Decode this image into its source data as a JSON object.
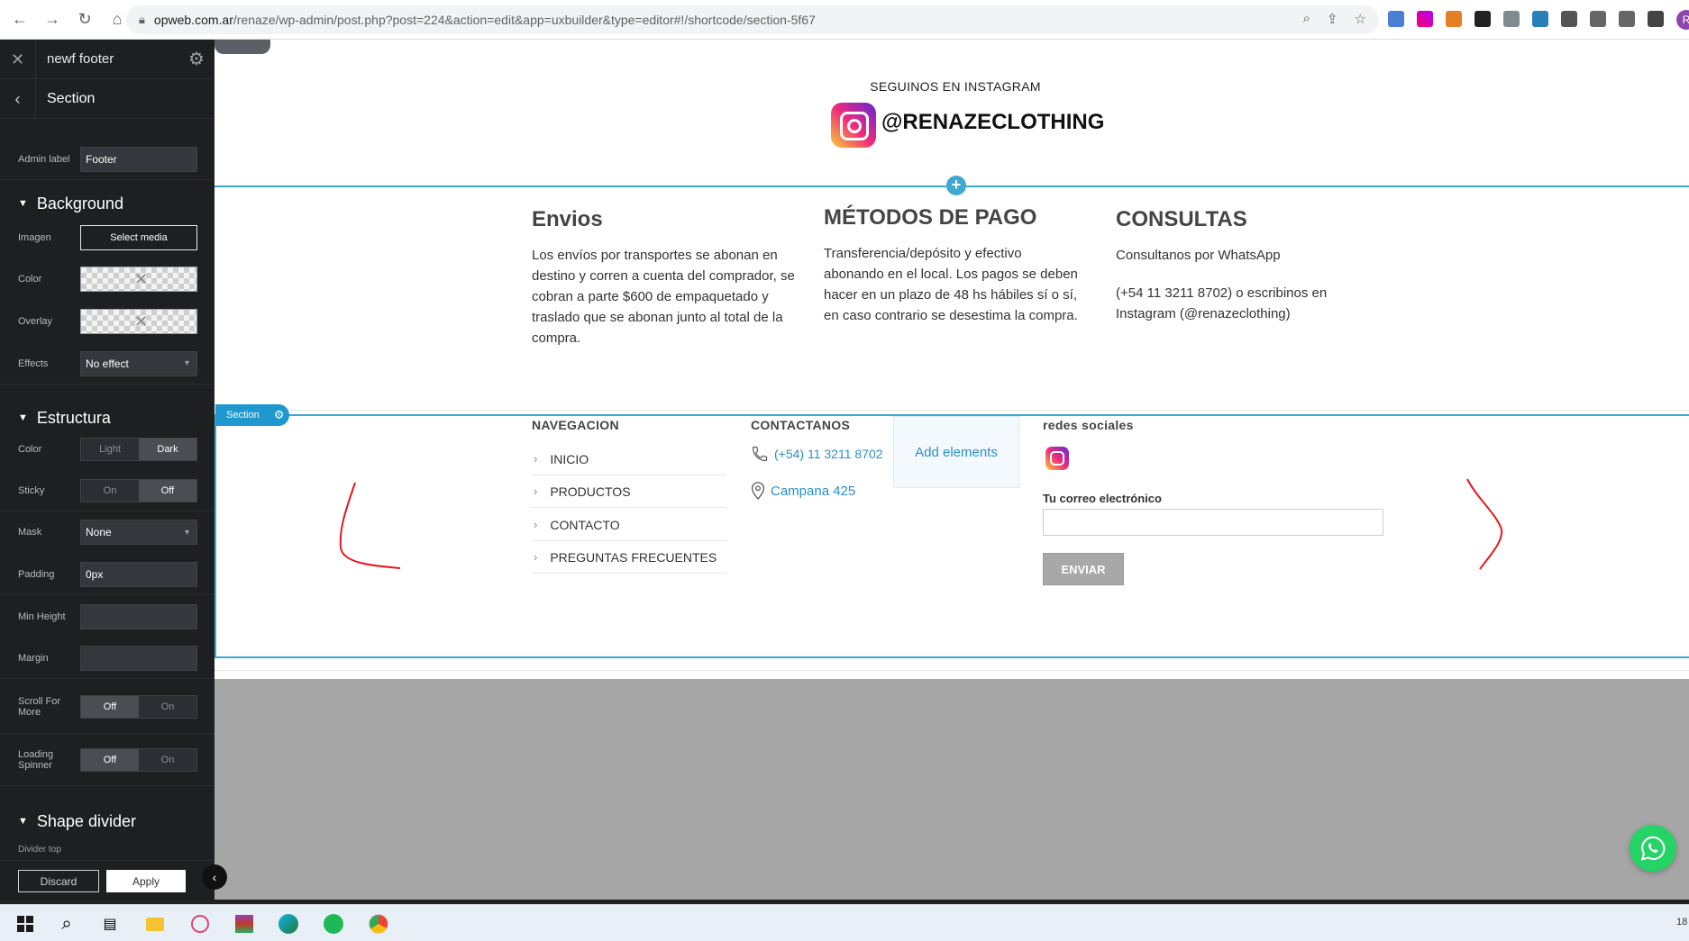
{
  "browser": {
    "url_host": "opweb.com.ar",
    "url_path": "/renaze/wp-admin/post.php?post=224&action=edit&app=uxbuilder&type=editor#!/shortcode/section-5f67",
    "profile_initial": "R"
  },
  "sidebar": {
    "title": "newf footer",
    "section_title": "Section",
    "admin_label": {
      "label": "Admin label",
      "value": "Footer"
    },
    "background": {
      "heading": "Background",
      "image": {
        "label": "Imagen",
        "button": "Select media"
      },
      "color": {
        "label": "Color"
      },
      "overlay": {
        "label": "Overlay"
      },
      "effects": {
        "label": "Effects",
        "value": "No effect"
      }
    },
    "estructura": {
      "heading": "Estructura",
      "color": {
        "label": "Color",
        "options": [
          "Light",
          "Dark"
        ],
        "selected": "Dark"
      },
      "sticky": {
        "label": "Sticky",
        "options": [
          "On",
          "Off"
        ],
        "selected": "Off"
      },
      "mask": {
        "label": "Mask",
        "value": "None"
      },
      "padding": {
        "label": "Padding",
        "value": "0px"
      },
      "min_height": {
        "label": "Min Height",
        "value": ""
      },
      "margin": {
        "label": "Margin",
        "value": ""
      },
      "scroll_for_more": {
        "label": "Scroll For More",
        "options": [
          "Off",
          "On"
        ],
        "selected": "Off"
      },
      "loading_spinner": {
        "label": "Loading Spinner",
        "options": [
          "Off",
          "On"
        ],
        "selected": "Off"
      }
    },
    "shape_divider": {
      "heading": "Shape divider",
      "sub": "Divider top"
    },
    "footer": {
      "discard": "Discard",
      "apply": "Apply"
    }
  },
  "canvas": {
    "instagram": {
      "title": "SEGUINOS EN INSTAGRAM",
      "handle": "@RENAZECLOTHING"
    },
    "columns": [
      {
        "heading": "Envios",
        "paragraphs": [
          "Los envíos por transportes se abonan en destino y corren a cuenta del comprador, se cobran a parte $600 de empaquetado y traslado que se abonan junto al total de la compra."
        ]
      },
      {
        "heading": "MÉTODOS DE PAGO",
        "paragraphs": [
          "Transferencia/depósito y efectivo abonando en el local. Los pagos se deben hacer en un plazo de 48 hs hábiles sí o sí, en caso contrario se desestima la compra."
        ]
      },
      {
        "heading": "CONSULTAS",
        "paragraphs": [
          "Consultanos por WhatsApp",
          "(+54 11 3211 8702) o escribinos en Instagram (@renazeclothing)"
        ]
      }
    ],
    "section_badge": "Section",
    "footer_section": {
      "nav": {
        "heading": "NAVEGACION",
        "items": [
          "INICIO",
          "PRODUCTOS",
          "CONTACTO",
          "PREGUNTAS FRECUENTES"
        ]
      },
      "contact": {
        "heading": "CONTACTANOS",
        "phone": "(+54) 11 3211 8702",
        "address": "Campana 425"
      },
      "add_elements": "Add elements",
      "social": {
        "heading": "redes sociales",
        "email_label": "Tu correo electrónico",
        "email_value": "",
        "send_label": "ENVIAR"
      }
    }
  },
  "taskbar": {
    "clock": "18"
  },
  "colors": {
    "accent": "#3fa9d1",
    "link": "#2b8fc7",
    "whatsapp": "#25d366",
    "sidebar_bg": "#1d1f21"
  }
}
